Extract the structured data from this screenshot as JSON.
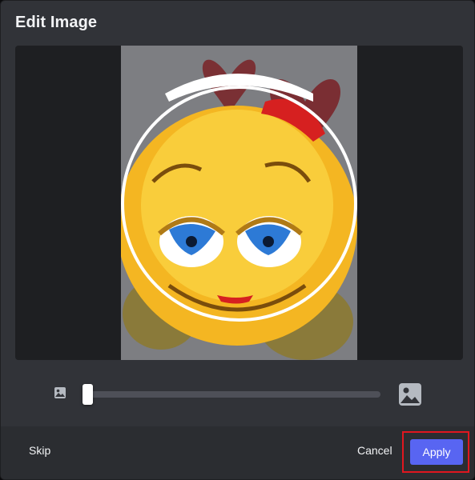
{
  "modal": {
    "title": "Edit Image"
  },
  "zoom": {
    "level": 0.0,
    "min_icon": "image-small-icon",
    "max_icon": "image-large-icon"
  },
  "footer": {
    "skip_label": "Skip",
    "cancel_label": "Cancel",
    "apply_label": "Apply"
  },
  "colors": {
    "modal_bg": "#313338",
    "footer_bg": "#2b2d31",
    "primary": "#5865f2",
    "highlight": "#e0171f"
  }
}
